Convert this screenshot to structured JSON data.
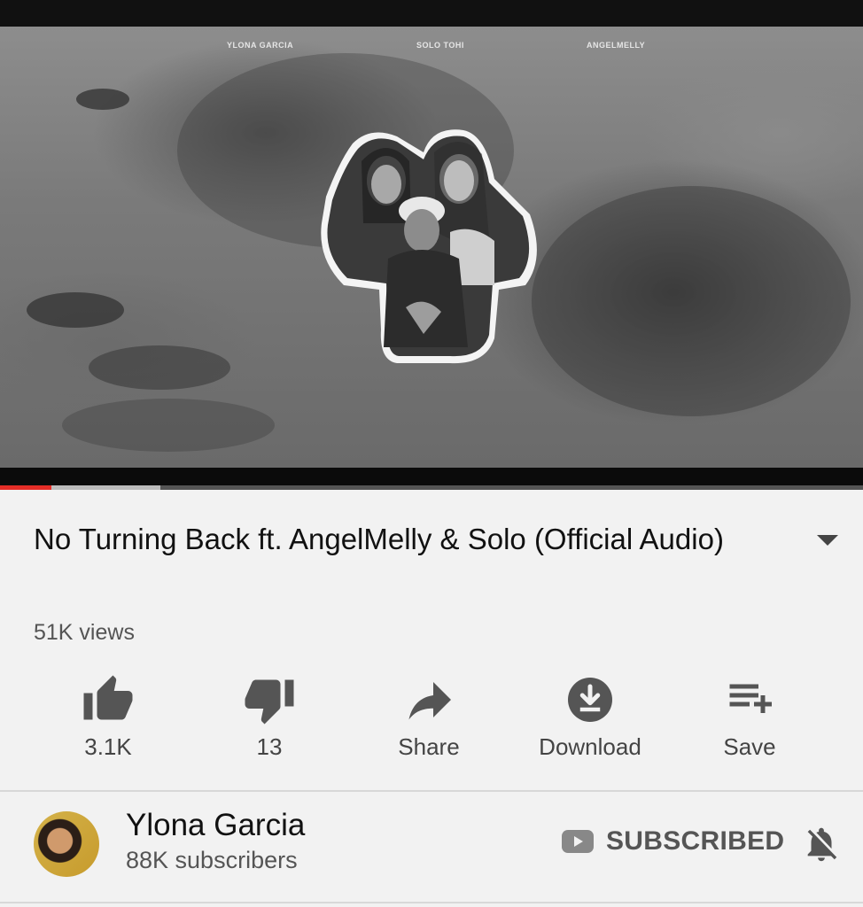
{
  "video": {
    "credits": [
      "YLONA GARCIA",
      "SOLO TOHI",
      "ANGELMELLY"
    ],
    "progress_played": 0.06,
    "progress_buffered": 0.186,
    "colors": {
      "played": "#e52d27",
      "buffer": "#bbbbbb"
    }
  },
  "info": {
    "title": "No Turning Back ft. AngelMelly & Solo (Official Audio)",
    "views": "51K views",
    "expand_icon": "triangle-down-icon"
  },
  "actions": [
    {
      "label": "3.1K",
      "icon": "thumb-up-icon"
    },
    {
      "label": "13",
      "icon": "thumb-down-icon"
    },
    {
      "label": "Share",
      "icon": "share-icon"
    },
    {
      "label": "Download",
      "icon": "download-icon"
    },
    {
      "label": "Save",
      "icon": "playlist-add-icon"
    }
  ],
  "channel": {
    "name": "Ylona Garcia",
    "subscribers": "88K subscribers",
    "subscribe_state": "SUBSCRIBED",
    "bell_icon": "notifications-off-icon"
  }
}
